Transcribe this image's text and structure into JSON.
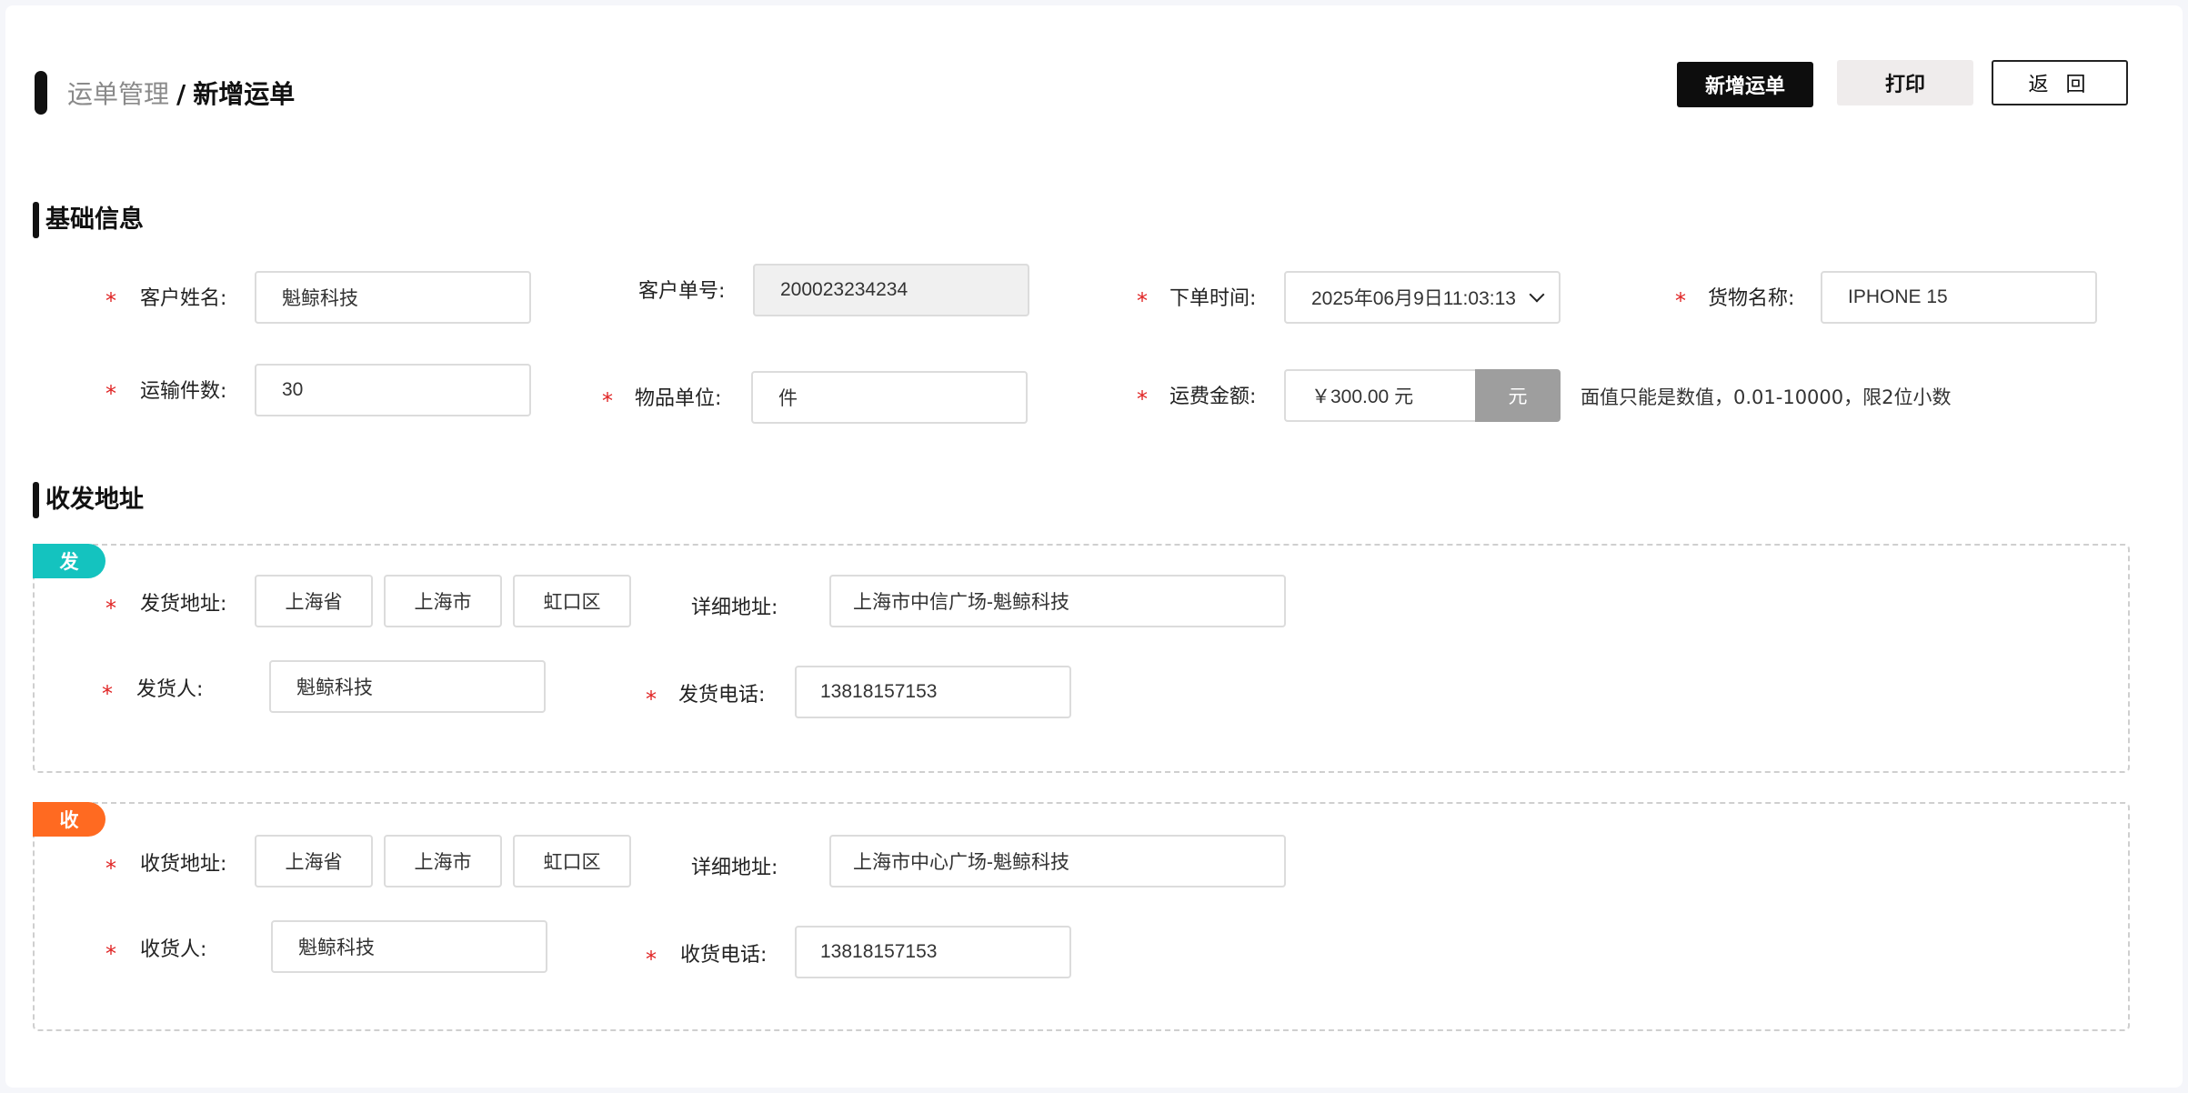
{
  "breadcrumb": {
    "parent": "运单管理",
    "separator": "/",
    "current": "新增运单"
  },
  "toolbar": {
    "new_label": "新增运单",
    "print_label": "打印",
    "back_label": "返 回"
  },
  "sections": {
    "basic": "基础信息",
    "address": "收发地址"
  },
  "basic": {
    "customer_name": {
      "label": "客户姓名:",
      "value": "魁鲸科技",
      "required": true
    },
    "customer_no": {
      "label": "客户单号:",
      "value": "200023234234",
      "required": false
    },
    "order_time": {
      "label": "下单时间:",
      "value": "2025年06月9日11:03:13",
      "required": true
    },
    "goods_name": {
      "label": "货物名称:",
      "value": "IPHONE 15",
      "required": true
    },
    "quantity": {
      "label": "运输件数:",
      "value": "30",
      "required": true
    },
    "unit": {
      "label": "物品单位:",
      "value": "件",
      "required": true
    },
    "freight": {
      "label": "运费金额:",
      "value": "￥300.00 元",
      "unit_button": "元",
      "required": true
    },
    "freight_hint": "面值只能是数值，0.01-10000，限2位小数"
  },
  "sender": {
    "tag": "发",
    "address_label": "发货地址:",
    "province": "上海省",
    "city": "上海市",
    "district": "虹口区",
    "detail_label": "详细地址:",
    "detail": "上海市中信广场-魁鲸科技",
    "person_label": "发货人:",
    "person": "魁鲸科技",
    "phone_label": "发货电话:",
    "phone": "13818157153"
  },
  "receiver": {
    "tag": "收",
    "address_label": "收货地址:",
    "province": "上海省",
    "city": "上海市",
    "district": "虹口区",
    "detail_label": "详细地址:",
    "detail": "上海市中心广场-魁鲸科技",
    "person_label": "收货人:",
    "person": "魁鲸科技",
    "phone_label": "收货电话:",
    "phone": "13818157153"
  },
  "required_mark": "*",
  "colors": {
    "primary_button": "#0d0d0d",
    "send_tag": "#14c3bf",
    "receive_tag": "#ff6a21",
    "required": "#e02424"
  },
  "icons": {
    "order_time_dropdown": "chevron-down-icon"
  }
}
